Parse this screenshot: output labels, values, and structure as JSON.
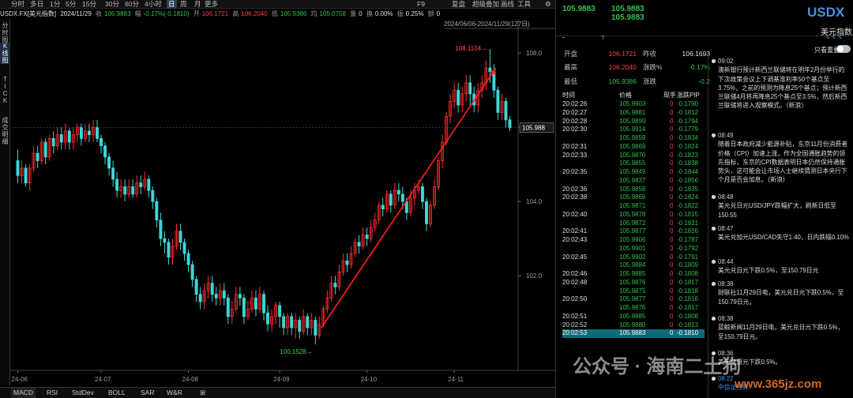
{
  "toolbar": {
    "periods": [
      "分时",
      "多日",
      "1分",
      "5分",
      "15分",
      "30分",
      "60分",
      "4小时",
      "日",
      "周",
      "月",
      "更多"
    ],
    "active_period": "日",
    "f9": "F9",
    "replay": "复盘",
    "overlay": "超级叠加",
    "draw": "画线",
    "tools": "工具"
  },
  "info": {
    "symbol": "USDX.FX[美元指数]",
    "date": "2024/11/29",
    "close_lbl": "收",
    "close": "105.9883",
    "change_lbl": "幅",
    "change": "-0.17%(-0.1810)",
    "open_lbl": "开",
    "open": "106.1721",
    "high_lbl": "高",
    "high": "106.2040",
    "low_lbl": "低",
    "low": "105.9386",
    "avg_lbl": "均",
    "avg": "105.0758",
    "vol_lbl": "量",
    "vol": "0",
    "turnover_lbl": "换",
    "turnover": "0.00%",
    "amp_lbl": "振",
    "amp": "0.25%",
    "amount_lbl": "额",
    "amount": "0"
  },
  "side_tabs": [
    "分时图",
    "K线图",
    "TICK",
    "成交明细"
  ],
  "chart_data": {
    "type": "candlestick",
    "range_label": "2024/06/06-2024/11/29(127日)",
    "y_ticks": [
      "108.0",
      "106.0",
      "104.0",
      "102.0"
    ],
    "x_ticks": [
      "24-06",
      "24-07",
      "24-08",
      "24-09",
      "24-10",
      "24-11"
    ],
    "price_label": "105.988",
    "max_label": "108.1104",
    "min_label": "100.1528",
    "ylim": [
      99.45,
      108.75
    ],
    "candles": [
      [
        105.1,
        104.7,
        105.4,
        104.5
      ],
      [
        104.7,
        104.9,
        105.1,
        104.5
      ],
      [
        104.9,
        104.5,
        105.0,
        104.4
      ],
      [
        104.5,
        104.9,
        105.0,
        104.3
      ],
      [
        104.9,
        105.3,
        105.5,
        104.8
      ],
      [
        105.3,
        105.1,
        105.5,
        104.9
      ],
      [
        105.1,
        105.6,
        105.7,
        105.0
      ],
      [
        105.6,
        105.2,
        105.7,
        105.0
      ],
      [
        105.2,
        105.7,
        105.8,
        105.1
      ],
      [
        105.7,
        105.5,
        105.9,
        105.3
      ],
      [
        105.5,
        105.8,
        106.0,
        105.4
      ],
      [
        105.8,
        105.6,
        106.0,
        105.4
      ],
      [
        105.6,
        105.9,
        106.1,
        105.4
      ],
      [
        105.9,
        105.6,
        106.0,
        105.4
      ],
      [
        105.6,
        105.8,
        106.0,
        105.4
      ],
      [
        105.8,
        106.0,
        106.1,
        105.6
      ],
      [
        106.0,
        105.7,
        106.1,
        105.5
      ],
      [
        105.7,
        105.9,
        106.1,
        105.6
      ],
      [
        105.9,
        105.8,
        106.1,
        105.6
      ],
      [
        105.8,
        106.0,
        106.2,
        105.6
      ],
      [
        106.0,
        105.7,
        106.2,
        105.6
      ],
      [
        105.7,
        105.5,
        105.8,
        105.3
      ],
      [
        105.5,
        105.2,
        105.6,
        105.0
      ],
      [
        105.2,
        104.9,
        105.3,
        104.7
      ],
      [
        104.9,
        104.6,
        105.1,
        104.4
      ],
      [
        104.6,
        104.3,
        104.8,
        104.1
      ],
      [
        104.3,
        104.4,
        104.6,
        104.1
      ],
      [
        104.4,
        104.2,
        104.6,
        104.0
      ],
      [
        104.2,
        104.4,
        104.6,
        104.1
      ],
      [
        104.4,
        104.2,
        104.6,
        104.1
      ],
      [
        104.2,
        104.5,
        104.7,
        104.1
      ],
      [
        104.5,
        104.4,
        104.7,
        104.2
      ],
      [
        104.4,
        104.6,
        104.8,
        104.3
      ],
      [
        104.6,
        104.3,
        104.7,
        104.1
      ],
      [
        104.3,
        104.0,
        104.4,
        103.8
      ],
      [
        104.0,
        103.5,
        104.1,
        103.3
      ],
      [
        103.5,
        103.0,
        103.7,
        102.8
      ],
      [
        103.0,
        102.9,
        103.2,
        102.6
      ],
      [
        102.9,
        102.5,
        103.0,
        102.3
      ],
      [
        102.5,
        102.8,
        103.0,
        102.3
      ],
      [
        102.8,
        103.2,
        103.4,
        102.7
      ],
      [
        103.2,
        102.9,
        103.4,
        102.7
      ],
      [
        102.9,
        102.6,
        103.0,
        102.4
      ],
      [
        102.6,
        102.3,
        102.7,
        102.1
      ],
      [
        102.3,
        101.9,
        102.4,
        101.7
      ],
      [
        101.9,
        101.5,
        102.0,
        101.3
      ],
      [
        101.5,
        101.3,
        101.7,
        101.1
      ],
      [
        101.3,
        101.6,
        101.8,
        101.1
      ],
      [
        101.6,
        101.8,
        102.0,
        101.4
      ],
      [
        101.8,
        101.5,
        102.0,
        101.3
      ],
      [
        101.5,
        101.4,
        101.7,
        101.2
      ],
      [
        101.4,
        101.6,
        101.8,
        101.2
      ],
      [
        101.6,
        101.4,
        101.8,
        101.2
      ],
      [
        101.4,
        100.9,
        101.5,
        100.7
      ],
      [
        100.9,
        101.1,
        101.3,
        100.7
      ],
      [
        101.1,
        101.5,
        101.7,
        101.0
      ],
      [
        101.5,
        101.4,
        101.7,
        101.2
      ],
      [
        101.4,
        100.9,
        101.5,
        100.7
      ],
      [
        100.9,
        101.1,
        101.3,
        100.8
      ],
      [
        101.1,
        101.4,
        101.6,
        101.0
      ],
      [
        101.4,
        101.1,
        101.6,
        100.9
      ],
      [
        101.1,
        101.5,
        101.7,
        101.0
      ],
      [
        101.5,
        101.0,
        101.6,
        100.8
      ],
      [
        101.0,
        100.7,
        101.2,
        100.5
      ],
      [
        100.7,
        100.9,
        101.1,
        100.5
      ],
      [
        100.9,
        101.2,
        101.3,
        100.7
      ],
      [
        101.2,
        100.9,
        101.3,
        100.6
      ],
      [
        100.9,
        100.6,
        101.0,
        100.4
      ],
      [
        100.6,
        100.9,
        101.0,
        100.4
      ],
      [
        100.9,
        100.6,
        101.0,
        100.4
      ],
      [
        100.6,
        100.8,
        101.0,
        100.3
      ],
      [
        100.8,
        100.5,
        100.9,
        100.3
      ],
      [
        100.5,
        100.9,
        101.1,
        100.4
      ],
      [
        100.9,
        100.6,
        101.0,
        100.4
      ],
      [
        100.6,
        100.8,
        101.0,
        100.4
      ],
      [
        100.8,
        100.4,
        100.9,
        100.15
      ],
      [
        100.4,
        100.7,
        100.9,
        100.3
      ],
      [
        100.7,
        101.1,
        101.2,
        100.6
      ],
      [
        101.1,
        101.4,
        101.6,
        101.0
      ],
      [
        101.4,
        101.8,
        102.0,
        101.3
      ],
      [
        101.8,
        101.7,
        102.0,
        101.5
      ],
      [
        101.7,
        102.1,
        102.3,
        101.6
      ],
      [
        102.1,
        102.4,
        102.6,
        102.0
      ],
      [
        102.4,
        102.3,
        102.6,
        102.1
      ],
      [
        102.3,
        102.6,
        102.8,
        102.2
      ],
      [
        102.6,
        102.9,
        103.0,
        102.5
      ],
      [
        102.9,
        102.8,
        103.1,
        102.6
      ],
      [
        102.8,
        103.1,
        103.3,
        102.7
      ],
      [
        103.1,
        103.0,
        103.3,
        102.8
      ],
      [
        103.0,
        103.3,
        103.5,
        102.9
      ],
      [
        103.3,
        103.5,
        103.7,
        103.2
      ],
      [
        103.5,
        103.9,
        104.0,
        103.4
      ],
      [
        103.9,
        103.8,
        104.1,
        103.6
      ],
      [
        103.8,
        104.2,
        104.3,
        103.7
      ],
      [
        104.2,
        103.9,
        104.3,
        103.7
      ],
      [
        103.9,
        104.3,
        104.5,
        103.8
      ],
      [
        104.3,
        104.2,
        104.5,
        104.0
      ],
      [
        104.2,
        104.0,
        104.4,
        103.8
      ],
      [
        104.0,
        103.7,
        104.1,
        103.5
      ],
      [
        103.7,
        104.1,
        104.3,
        103.6
      ],
      [
        104.1,
        104.3,
        104.5,
        103.9
      ],
      [
        104.3,
        104.4,
        104.6,
        104.2
      ],
      [
        104.4,
        104.0,
        104.5,
        103.8
      ],
      [
        104.0,
        103.4,
        104.1,
        103.2
      ],
      [
        103.4,
        103.9,
        104.0,
        103.3
      ],
      [
        103.9,
        104.4,
        104.6,
        103.8
      ],
      [
        104.4,
        105.1,
        105.2,
        104.3
      ],
      [
        105.1,
        105.6,
        105.8,
        104.9
      ],
      [
        105.6,
        106.3,
        106.4,
        105.5
      ],
      [
        106.3,
        106.7,
        106.9,
        106.1
      ],
      [
        106.7,
        107.0,
        107.2,
        106.5
      ],
      [
        107.0,
        106.6,
        107.2,
        106.4
      ],
      [
        106.6,
        106.9,
        107.1,
        106.4
      ],
      [
        106.9,
        107.2,
        107.4,
        106.7
      ],
      [
        107.2,
        106.9,
        107.4,
        106.6
      ],
      [
        106.9,
        106.6,
        107.1,
        106.4
      ],
      [
        106.6,
        107.0,
        107.2,
        106.4
      ],
      [
        107.0,
        107.2,
        107.4,
        106.8
      ],
      [
        107.2,
        107.6,
        107.8,
        107.0
      ],
      [
        107.6,
        107.5,
        108.11,
        107.2
      ],
      [
        107.5,
        107.0,
        107.7,
        106.8
      ],
      [
        107.0,
        106.4,
        107.1,
        106.2
      ],
      [
        106.4,
        106.7,
        106.9,
        106.2
      ],
      [
        106.7,
        106.2,
        106.8,
        106.0
      ],
      [
        106.2,
        105.99,
        106.3,
        105.9
      ]
    ]
  },
  "bottom_tabs": [
    "MACD",
    "RSI",
    "StdDev",
    "BOLL",
    "SAR",
    "W&R"
  ],
  "quote": {
    "last": "105.9883",
    "bid": "105.9883",
    "ask": "105.9883",
    "dash": "-",
    "question": "?",
    "symbol": "USDX",
    "name": "美元指数",
    "open_lbl": "开盘",
    "open": "106.1721",
    "prev_lbl": "昨收",
    "prev": "106.1693",
    "high_lbl": "最高",
    "high": "106.2040",
    "chgpct_lbl": "涨跌%",
    "chgpct": "-0.17%",
    "low_lbl": "最低",
    "low": "105.9386",
    "chg_lbl": "涨跌",
    "chg": "-0.2",
    "only_important": "只看重要"
  },
  "ticks_header": {
    "time": "时间",
    "price": "价格",
    "vol": "现手",
    "pip": "涨跌PIP"
  },
  "ticks": [
    {
      "t": "20:02:26",
      "p": "105.9903",
      "v": "0",
      "c": "-0.1790"
    },
    {
      "t": "20:02:27",
      "p": "105.9881",
      "v": "0",
      "c": "-0.1812"
    },
    {
      "t": "20:02:28",
      "p": "105.9899",
      "v": "0",
      "c": "-0.1794"
    },
    {
      "t": "20:02:30",
      "p": "105.9914",
      "v": "0",
      "c": "-0.1779"
    },
    {
      "t": "",
      "p": "105.9859",
      "v": "0",
      "c": "-0.1834"
    },
    {
      "t": "20:02:31",
      "p": "105.9869",
      "v": "0",
      "c": "-0.1824"
    },
    {
      "t": "20:02:33",
      "p": "105.9870",
      "v": "0",
      "c": "-0.1823"
    },
    {
      "t": "",
      "p": "105.9855",
      "v": "0",
      "c": "-0.1838"
    },
    {
      "t": "20:02:35",
      "p": "105.9849",
      "v": "0",
      "c": "-0.1844"
    },
    {
      "t": "",
      "p": "105.9837",
      "v": "0",
      "c": "-0.1856"
    },
    {
      "t": "20:02:36",
      "p": "105.9858",
      "v": "0",
      "c": "-0.1835"
    },
    {
      "t": "20:02:38",
      "p": "105.9869",
      "v": "0",
      "c": "-0.1824"
    },
    {
      "t": "",
      "p": "105.9871",
      "v": "0",
      "c": "-0.1822"
    },
    {
      "t": "20:02:40",
      "p": "105.9878",
      "v": "0",
      "c": "-0.1815"
    },
    {
      "t": "",
      "p": "105.9872",
      "v": "0",
      "c": "-0.1821"
    },
    {
      "t": "20:02:41",
      "p": "105.9877",
      "v": "0",
      "c": "-0.1816"
    },
    {
      "t": "20:02:43",
      "p": "105.9906",
      "v": "0",
      "c": "-0.1787"
    },
    {
      "t": "",
      "p": "105.9901",
      "v": "0",
      "c": "-0.1792"
    },
    {
      "t": "20:02:45",
      "p": "105.9902",
      "v": "0",
      "c": "-0.1791"
    },
    {
      "t": "",
      "p": "105.9884",
      "v": "0",
      "c": "-0.1809"
    },
    {
      "t": "20:02:46",
      "p": "105.9885",
      "v": "0",
      "c": "-0.1808"
    },
    {
      "t": "20:02:48",
      "p": "105.9876",
      "v": "0",
      "c": "-0.1817"
    },
    {
      "t": "",
      "p": "105.9875",
      "v": "0",
      "c": "-0.1818"
    },
    {
      "t": "20:02:50",
      "p": "105.9877",
      "v": "0",
      "c": "-0.1816"
    },
    {
      "t": "",
      "p": "105.9876",
      "v": "0",
      "c": "-0.1817"
    },
    {
      "t": "20:02:51",
      "p": "105.9885",
      "v": "0",
      "c": "-0.1808"
    },
    {
      "t": "20:02:52",
      "p": "105.9880",
      "v": "0",
      "c": "-0.1813"
    },
    {
      "t": "20:02:53",
      "p": "105.9883",
      "v": "0",
      "c": "-0.1810"
    }
  ],
  "news": [
    {
      "time": "09:02",
      "text": "澳新银行预计新西兰联储将在明年2月份举行的下次政策会议上下调基准利率50个基点至3.75%，之前的预测为降息25个基点；预计新西兰联储4月将再降息25个基点至3.5%，然后新西兰联储将进入观察模式。（新浪）"
    },
    {
      "time": "08:49",
      "text": "随着日本政府减少能源补贴，东京11月份消费者价格（CPI）加速上涨，作为全国通胀趋势的领先指标，东京的CPI数据表明日本仍然保持通胀势头，这可能会让市场人士继续猜测日本央行下个月是否会加息。（新浪）"
    },
    {
      "time": "08:48",
      "text": "美元兑日元USD/JPY跌幅扩大，刷新日低至150.55"
    },
    {
      "time": "08:47",
      "text": "美元兑加元USD/CAD失守1.40，日内跌幅0.10%"
    },
    {
      "time": "08:44",
      "text": "美元兑日元下跌0.5%，至150.79日元"
    },
    {
      "time": "08:38",
      "text": "财联社11月29日电，美元兑日元下跌0.5%，至150.79日元。"
    },
    {
      "time": "08:38",
      "text": "蓝鲸新闻11月29日电，美元兑日元下跌0.5%，至150.79日元。"
    },
    {
      "time": "08:36",
      "text": "美元兑日元下跌0.5%。"
    },
    {
      "time": "08:22",
      "text": "中信证券称..."
    }
  ],
  "watermark": {
    "text": "公众号 · 海南二土狗",
    "site": "www.365jz.com"
  }
}
